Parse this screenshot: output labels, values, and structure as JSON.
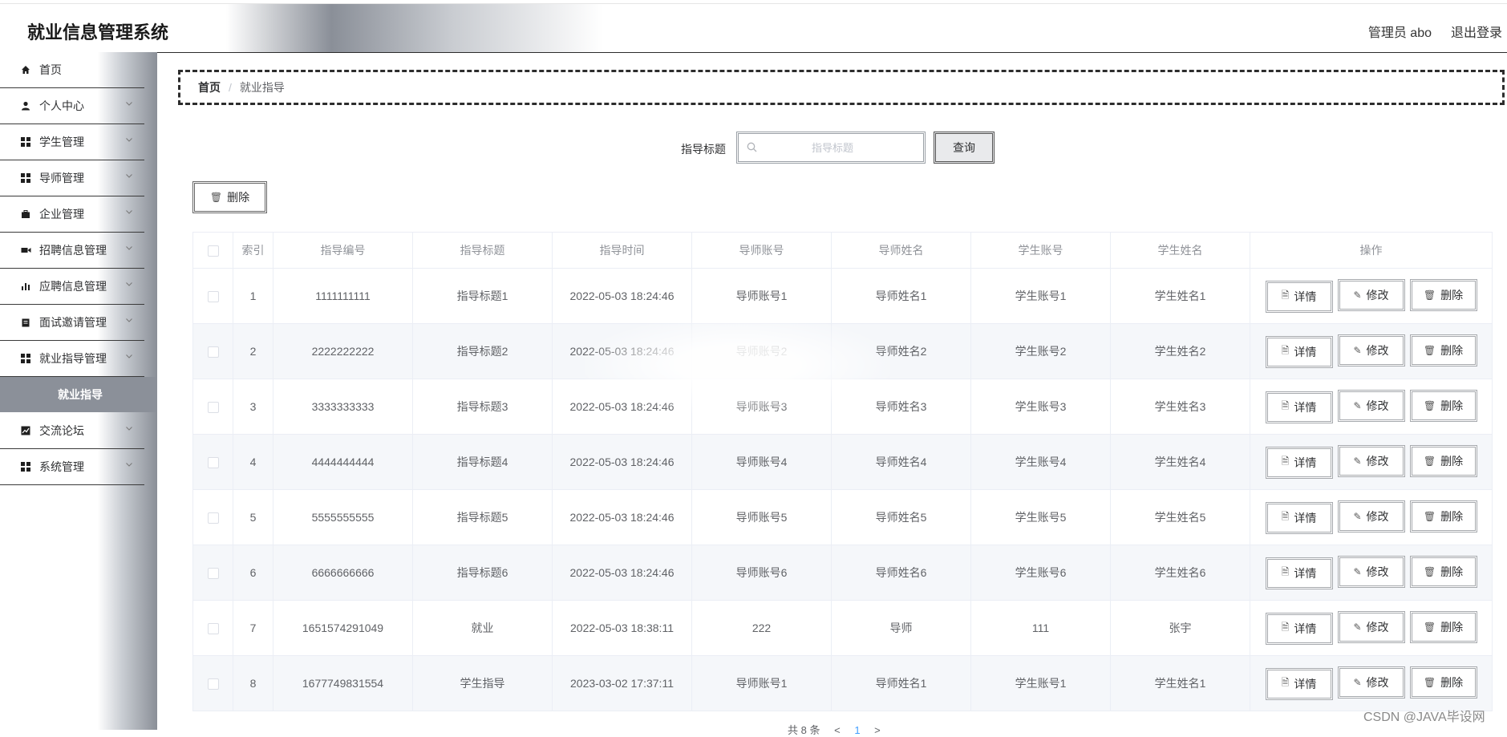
{
  "header": {
    "title": "就业信息管理系统",
    "user": "管理员 abo",
    "logout": "退出登录"
  },
  "sidebar": {
    "items": [
      {
        "label": "首页",
        "icon": "home-icon"
      },
      {
        "label": "个人中心",
        "icon": "user-icon"
      },
      {
        "label": "学生管理",
        "icon": "grid-icon"
      },
      {
        "label": "导师管理",
        "icon": "grid-icon"
      },
      {
        "label": "企业管理",
        "icon": "briefcase-icon"
      },
      {
        "label": "招聘信息管理",
        "icon": "video-icon"
      },
      {
        "label": "应聘信息管理",
        "icon": "bar-chart-icon"
      },
      {
        "label": "面试邀请管理",
        "icon": "clipboard-icon"
      },
      {
        "label": "就业指导管理",
        "icon": "grid-icon"
      },
      {
        "label": "交流论坛",
        "icon": "line-chart-icon"
      },
      {
        "label": "系统管理",
        "icon": "grid-icon"
      }
    ],
    "sub_active": "就业指导"
  },
  "breadcrumb": {
    "home": "首页",
    "separator": "/",
    "current": "就业指导"
  },
  "search": {
    "label": "指导标题",
    "placeholder": "指导标题",
    "query_button": "查询"
  },
  "toolbar": {
    "delete_label": "删除"
  },
  "table": {
    "headers": [
      "索引",
      "指导编号",
      "指导标题",
      "指导时间",
      "导师账号",
      "导师姓名",
      "学生账号",
      "学生姓名",
      "操作"
    ],
    "actions": {
      "detail": "详情",
      "edit": "修改",
      "delete": "删除"
    },
    "rows": [
      {
        "index": "1",
        "code": "1111111111",
        "title": "指导标题1",
        "time": "2022-05-03 18:24:46",
        "tutor_account": "导师账号1",
        "tutor_name": "导师姓名1",
        "student_account": "学生账号1",
        "student_name": "学生姓名1"
      },
      {
        "index": "2",
        "code": "2222222222",
        "title": "指导标题2",
        "time": "2022-05-03 18:24:46",
        "tutor_account": "导师账号2",
        "tutor_name": "导师姓名2",
        "student_account": "学生账号2",
        "student_name": "学生姓名2"
      },
      {
        "index": "3",
        "code": "3333333333",
        "title": "指导标题3",
        "time": "2022-05-03 18:24:46",
        "tutor_account": "导师账号3",
        "tutor_name": "导师姓名3",
        "student_account": "学生账号3",
        "student_name": "学生姓名3"
      },
      {
        "index": "4",
        "code": "4444444444",
        "title": "指导标题4",
        "time": "2022-05-03 18:24:46",
        "tutor_account": "导师账号4",
        "tutor_name": "导师姓名4",
        "student_account": "学生账号4",
        "student_name": "学生姓名4"
      },
      {
        "index": "5",
        "code": "5555555555",
        "title": "指导标题5",
        "time": "2022-05-03 18:24:46",
        "tutor_account": "导师账号5",
        "tutor_name": "导师姓名5",
        "student_account": "学生账号5",
        "student_name": "学生姓名5"
      },
      {
        "index": "6",
        "code": "6666666666",
        "title": "指导标题6",
        "time": "2022-05-03 18:24:46",
        "tutor_account": "导师账号6",
        "tutor_name": "导师姓名6",
        "student_account": "学生账号6",
        "student_name": "学生姓名6"
      },
      {
        "index": "7",
        "code": "1651574291049",
        "title": "就业",
        "time": "2022-05-03 18:38:11",
        "tutor_account": "222",
        "tutor_name": "导师",
        "student_account": "111",
        "student_name": "张宇"
      },
      {
        "index": "8",
        "code": "1677749831554",
        "title": "学生指导",
        "time": "2023-03-02 17:37:11",
        "tutor_account": "导师账号1",
        "tutor_name": "导师姓名1",
        "student_account": "学生账号1",
        "student_name": "学生姓名1"
      }
    ]
  },
  "pagination": {
    "total_text": "共 8 条",
    "prev": "<",
    "page": "1",
    "next": ">"
  },
  "watermark": "CSDN @JAVA毕设网"
}
